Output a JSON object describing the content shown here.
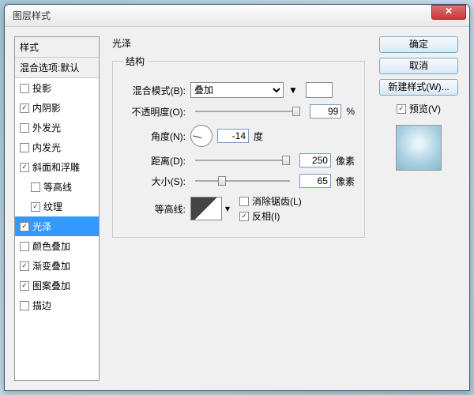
{
  "window": {
    "title": "图层样式"
  },
  "leftPanel": {
    "header": "样式",
    "subheader": "混合选项:默认",
    "items": [
      {
        "label": "投影",
        "checked": false,
        "indent": false
      },
      {
        "label": "内阴影",
        "checked": true,
        "indent": false
      },
      {
        "label": "外发光",
        "checked": false,
        "indent": false
      },
      {
        "label": "内发光",
        "checked": false,
        "indent": false
      },
      {
        "label": "斜面和浮雕",
        "checked": true,
        "indent": false
      },
      {
        "label": "等高线",
        "checked": false,
        "indent": true
      },
      {
        "label": "纹理",
        "checked": true,
        "indent": true
      },
      {
        "label": "光泽",
        "checked": true,
        "indent": false,
        "selected": true
      },
      {
        "label": "颜色叠加",
        "checked": false,
        "indent": false
      },
      {
        "label": "渐变叠加",
        "checked": true,
        "indent": false
      },
      {
        "label": "图案叠加",
        "checked": true,
        "indent": false
      },
      {
        "label": "描边",
        "checked": false,
        "indent": false
      }
    ]
  },
  "mid": {
    "title": "光泽",
    "group": "结构",
    "blendMode": {
      "label": "混合模式(B):",
      "value": "叠加"
    },
    "opacity": {
      "label": "不透明度(O):",
      "value": "99",
      "unit": "%"
    },
    "angle": {
      "label": "角度(N):",
      "value": "-14",
      "unit": "度"
    },
    "distance": {
      "label": "距离(D):",
      "value": "250",
      "unit": "像素"
    },
    "size": {
      "label": "大小(S):",
      "value": "65",
      "unit": "像素"
    },
    "contour": {
      "label": "等高线:"
    },
    "antialias": {
      "label": "消除锯齿(L)",
      "checked": false
    },
    "invert": {
      "label": "反相(I)",
      "checked": true
    }
  },
  "right": {
    "ok": "确定",
    "cancel": "取消",
    "newStyle": "新建样式(W)...",
    "preview": {
      "label": "预览(V)",
      "checked": true
    }
  }
}
